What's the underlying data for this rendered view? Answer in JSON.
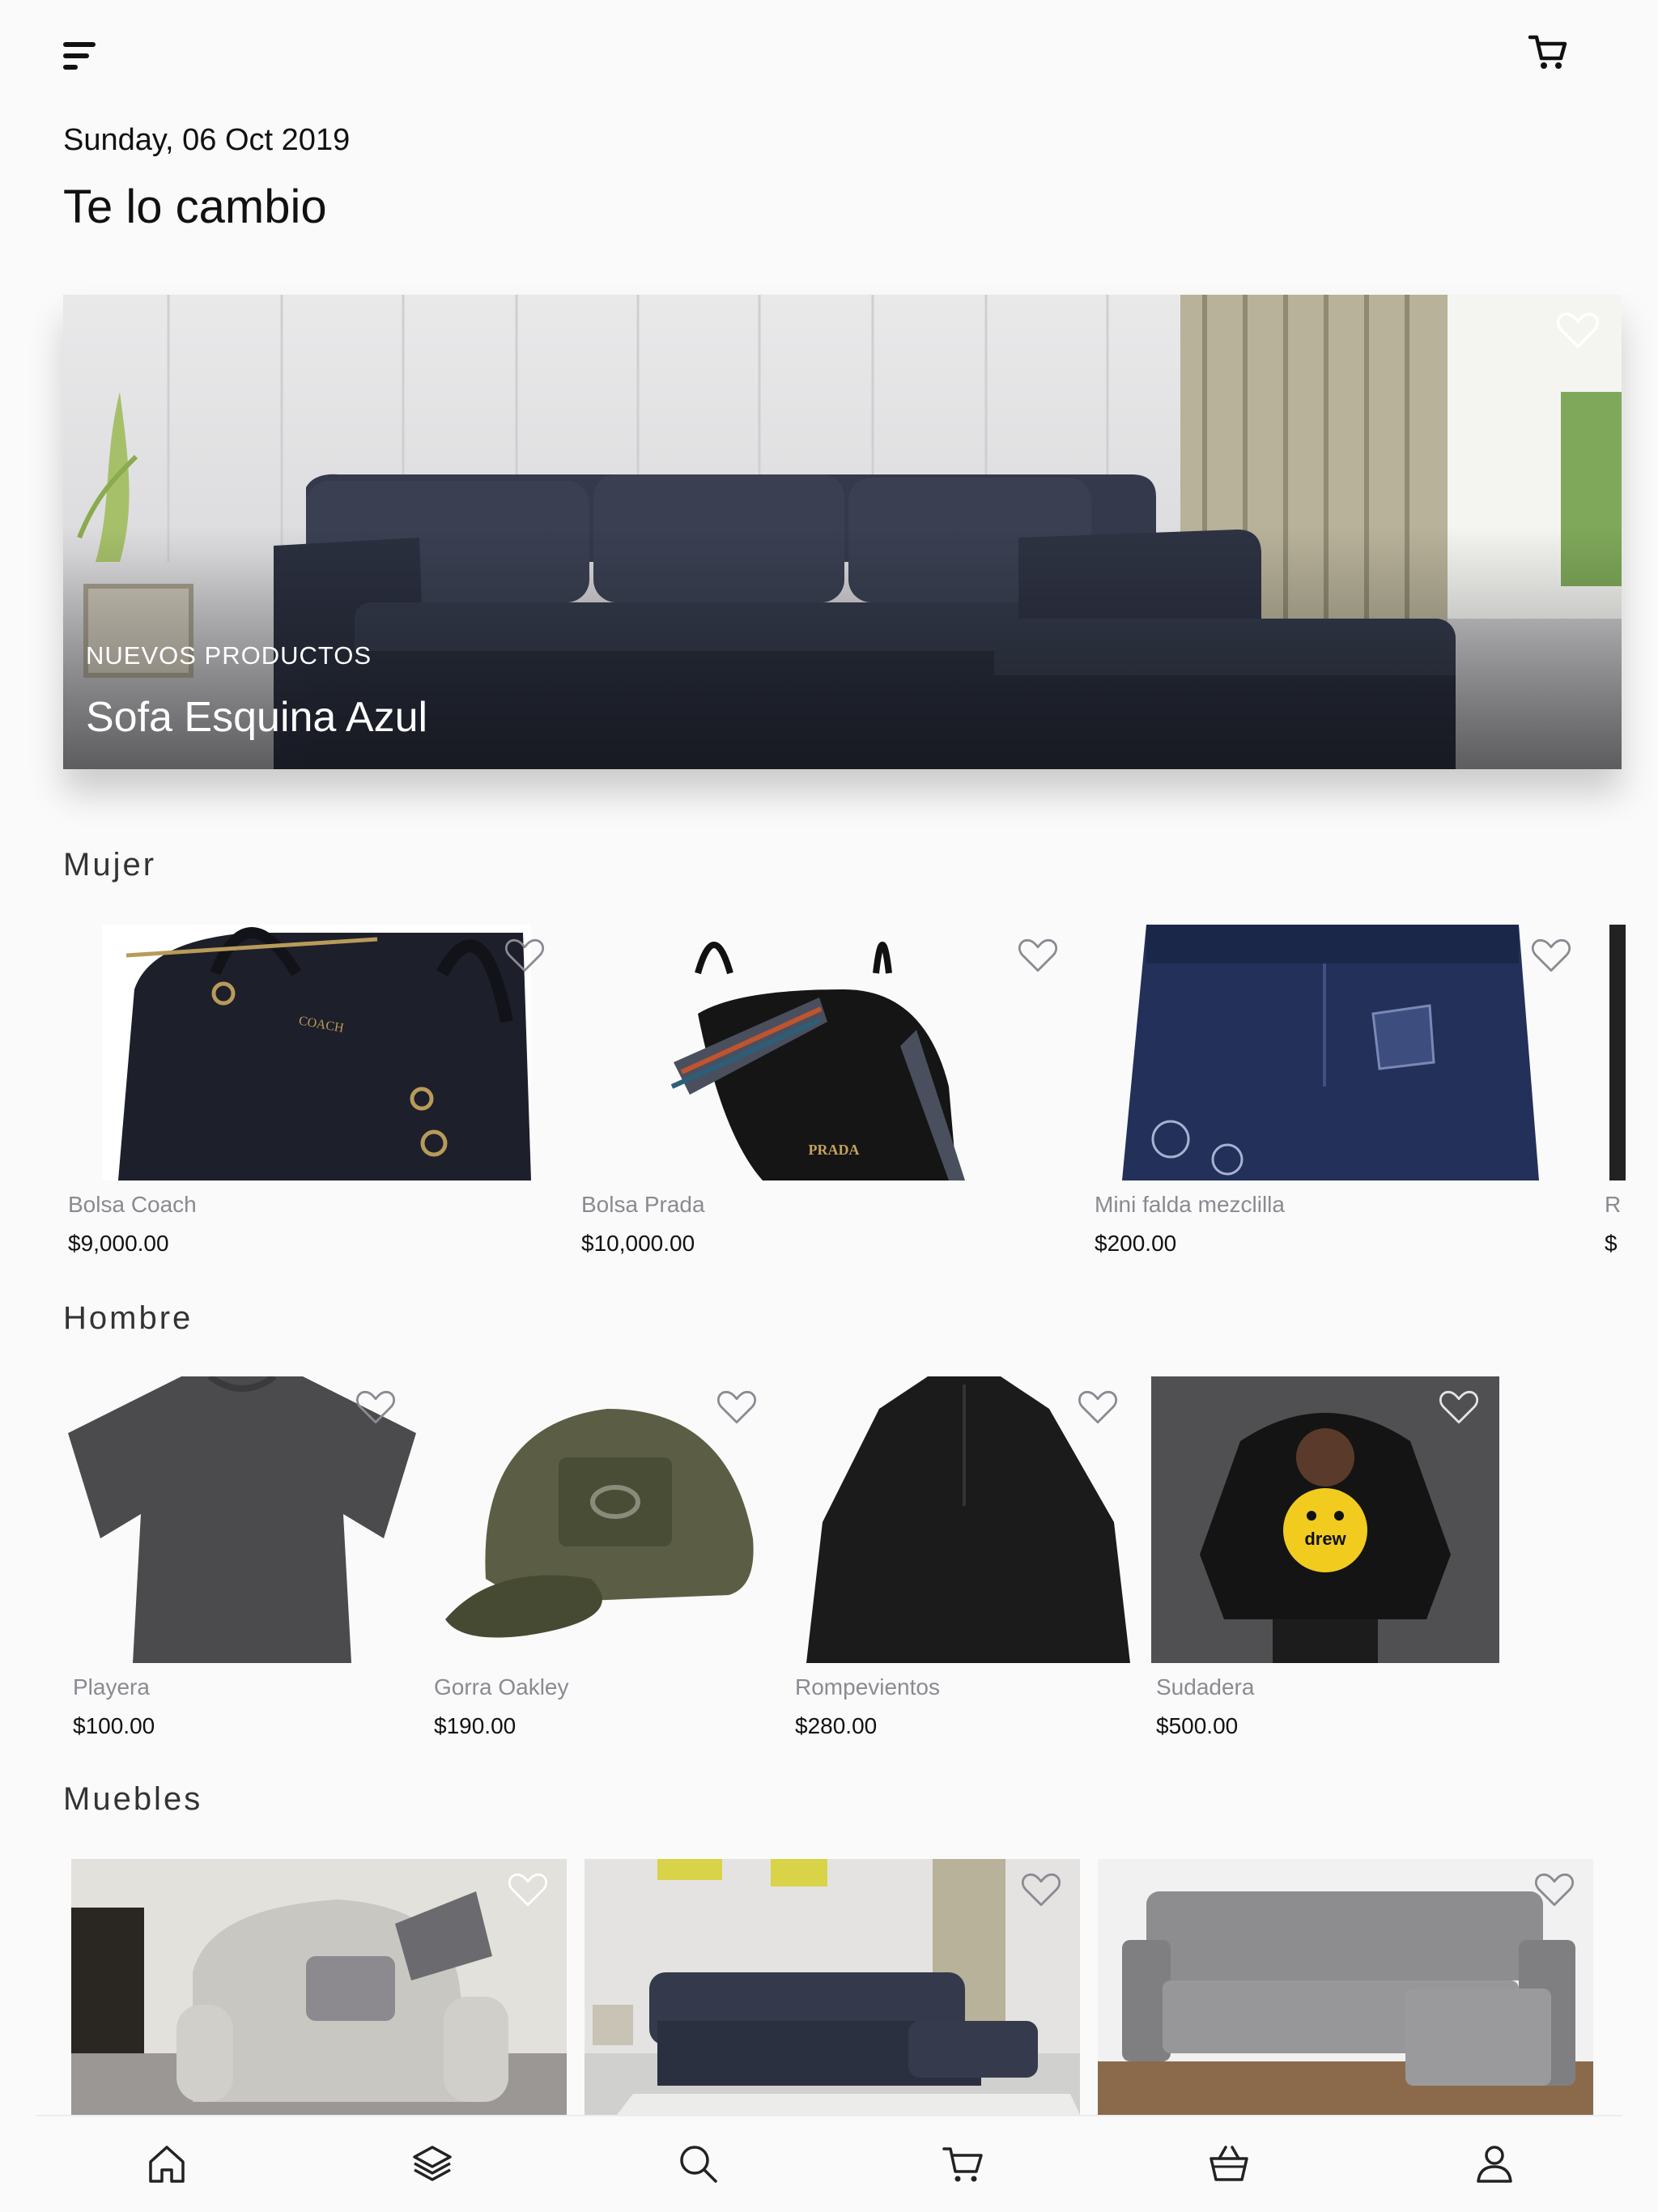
{
  "header": {
    "date": "Sunday, 06 Oct 2019",
    "title": "Te lo cambio",
    "icons": {
      "menu": "menu-icon",
      "cart": "cart-icon"
    }
  },
  "hero": {
    "kicker": "NUEVOS PRODUCTOS",
    "title": "Sofa Esquina Azul",
    "favorite_icon": "heart-outline-icon"
  },
  "sections": {
    "mujer": {
      "title": "Mujer",
      "items": [
        {
          "name": "Bolsa Coach",
          "price": "$9,000.00"
        },
        {
          "name": "Bolsa Prada",
          "price": "$10,000.00"
        },
        {
          "name": "Mini falda mezclilla",
          "price": "$200.00"
        },
        {
          "name": "R",
          "price": "$"
        }
      ]
    },
    "hombre": {
      "title": "Hombre",
      "items": [
        {
          "name": "Playera",
          "price": "$100.00"
        },
        {
          "name": "Gorra Oakley",
          "price": "$190.00"
        },
        {
          "name": "Rompevientos",
          "price": "$280.00"
        },
        {
          "name": "Sudadera",
          "price": "$500.00"
        }
      ]
    },
    "muebles": {
      "title": "Muebles",
      "items": [
        {
          "name": "",
          "price": ""
        },
        {
          "name": "",
          "price": ""
        },
        {
          "name": "",
          "price": ""
        }
      ]
    }
  },
  "product_text": {
    "coach_logo": "COACH",
    "prada_logo": "PRADA",
    "drew_logo": "drew"
  },
  "bottom_nav": [
    {
      "icon": "home-icon"
    },
    {
      "icon": "layers-icon"
    },
    {
      "icon": "search-icon"
    },
    {
      "icon": "cart-icon"
    },
    {
      "icon": "basket-icon"
    },
    {
      "icon": "user-icon"
    }
  ],
  "colors": {
    "background": "#fafafa",
    "text": "#111111",
    "muted": "#8a8a92",
    "sofa_navy": "#2c3140",
    "denim": "#22305a"
  }
}
